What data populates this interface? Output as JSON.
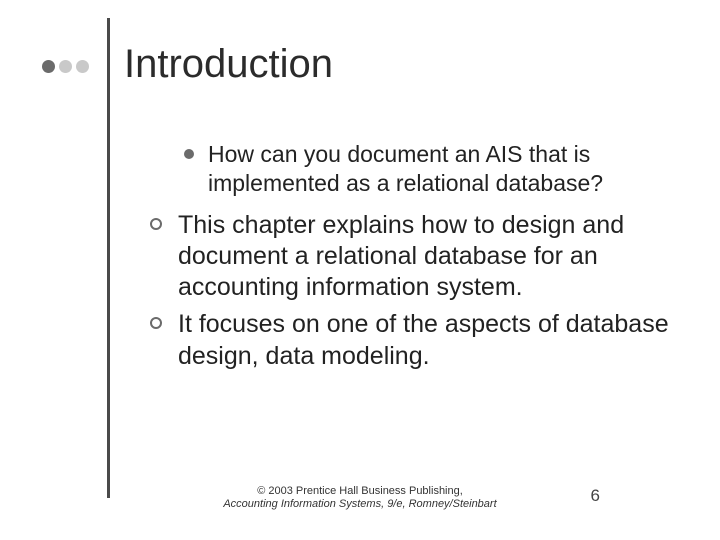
{
  "title": "Introduction",
  "bullets": {
    "sub1": "How can you document an AIS that is implemented as a relational database?",
    "main1": "This chapter explains how to design and document a relational database for an accounting information system.",
    "main2": "It focuses on one of the aspects of database design, data modeling."
  },
  "footer": {
    "line1": "© 2003 Prentice Hall Business Publishing,",
    "line2": "Accounting Information Systems, 9/e, Romney/Steinbart"
  },
  "page_number": "6"
}
